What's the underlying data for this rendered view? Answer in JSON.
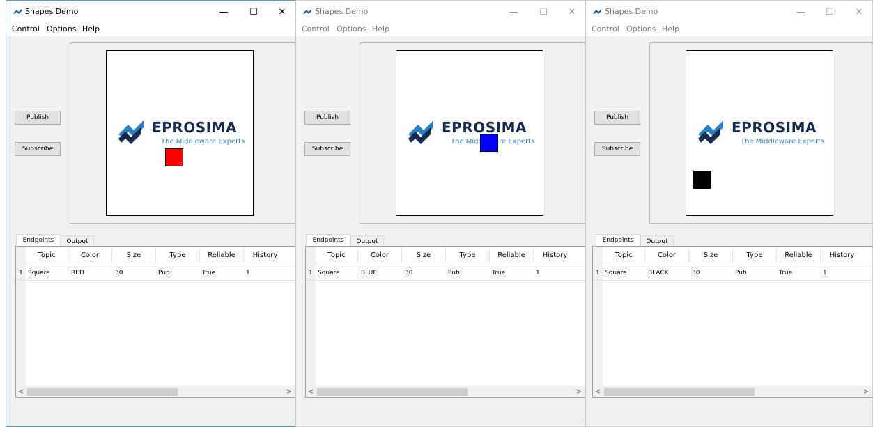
{
  "app": {
    "title": "Shapes Demo",
    "menu": [
      "Control",
      "Options",
      "Help"
    ],
    "publish_label": "Publish",
    "subscribe_label": "Subscribe",
    "tabs": [
      "Endpoints",
      "Output"
    ],
    "columns": [
      "Topic",
      "Color",
      "Size",
      "Type",
      "Reliable",
      "History"
    ],
    "logo": {
      "name": "EPROSIMA",
      "tagline": "The Middleware Experts"
    },
    "window_controls": {
      "minimize": "—",
      "maximize": "☐",
      "close": "✕"
    }
  },
  "windows": [
    {
      "state": "active",
      "shape_color": "#ff0000",
      "row": {
        "index": "1",
        "topic": "Square",
        "color": "RED",
        "size": "30",
        "type": "Pub",
        "reliable": "True",
        "history": "1"
      }
    },
    {
      "state": "inactive",
      "shape_color": "#0000ff",
      "row": {
        "index": "1",
        "topic": "Square",
        "color": "BLUE",
        "size": "30",
        "type": "Pub",
        "reliable": "True",
        "history": "1"
      }
    },
    {
      "state": "inactive",
      "shape_color": "#000000",
      "row": {
        "index": "1",
        "topic": "Square",
        "color": "BLACK",
        "size": "30",
        "type": "Pub",
        "reliable": "True",
        "history": "1"
      }
    }
  ]
}
